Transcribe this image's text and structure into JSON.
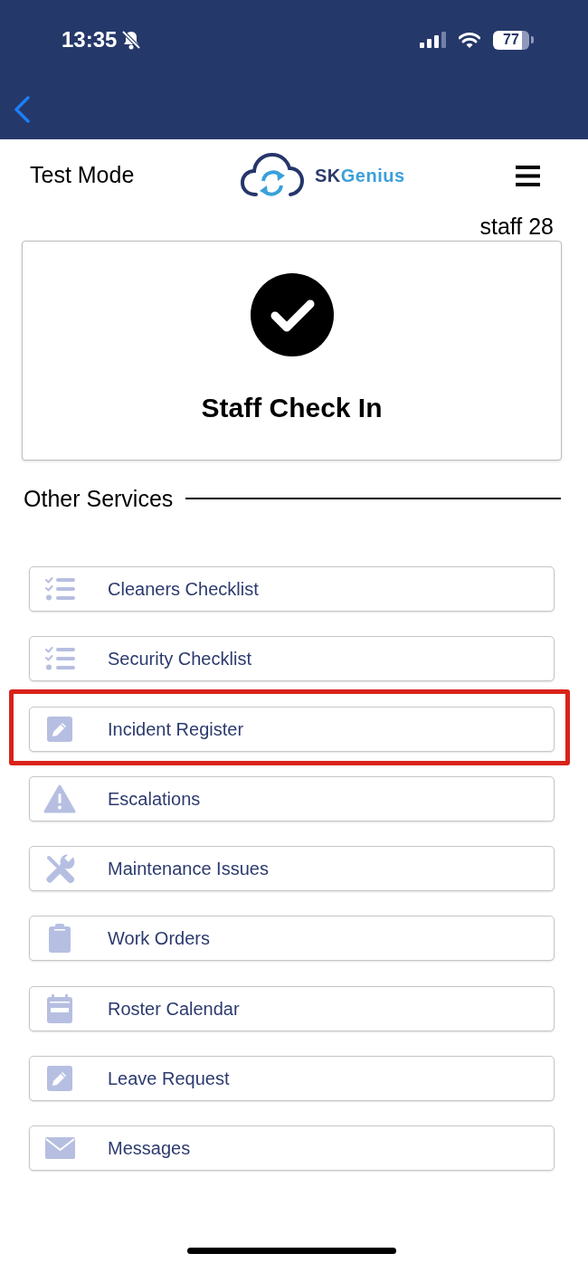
{
  "status_bar": {
    "time": "13:35",
    "battery": "77"
  },
  "header": {
    "mode": "Test Mode",
    "logo": [
      {
        "text": "SK",
        "color": "#2b3a6c"
      },
      {
        "text": "Genius",
        "color": "#3aa0da"
      }
    ],
    "user": "staff 28"
  },
  "check_in": {
    "label": "Staff Check In"
  },
  "other_services": {
    "title": "Other Services",
    "items": [
      {
        "label": "Cleaners Checklist",
        "kind": "checklist",
        "highlighted": false
      },
      {
        "label": "Security Checklist",
        "kind": "checklist",
        "highlighted": false
      },
      {
        "label": "Incident Register",
        "kind": "pencil",
        "highlighted": true
      },
      {
        "label": "Escalations",
        "kind": "warning",
        "highlighted": false
      },
      {
        "label": "Maintenance Issues",
        "kind": "tools",
        "highlighted": false
      },
      {
        "label": "Work Orders",
        "kind": "clipboard",
        "highlighted": false
      },
      {
        "label": "Roster Calendar",
        "kind": "calendar",
        "highlighted": false
      },
      {
        "label": "Leave Request",
        "kind": "pencil",
        "highlighted": false
      },
      {
        "label": "Messages",
        "kind": "envelope",
        "highlighted": false
      }
    ]
  }
}
